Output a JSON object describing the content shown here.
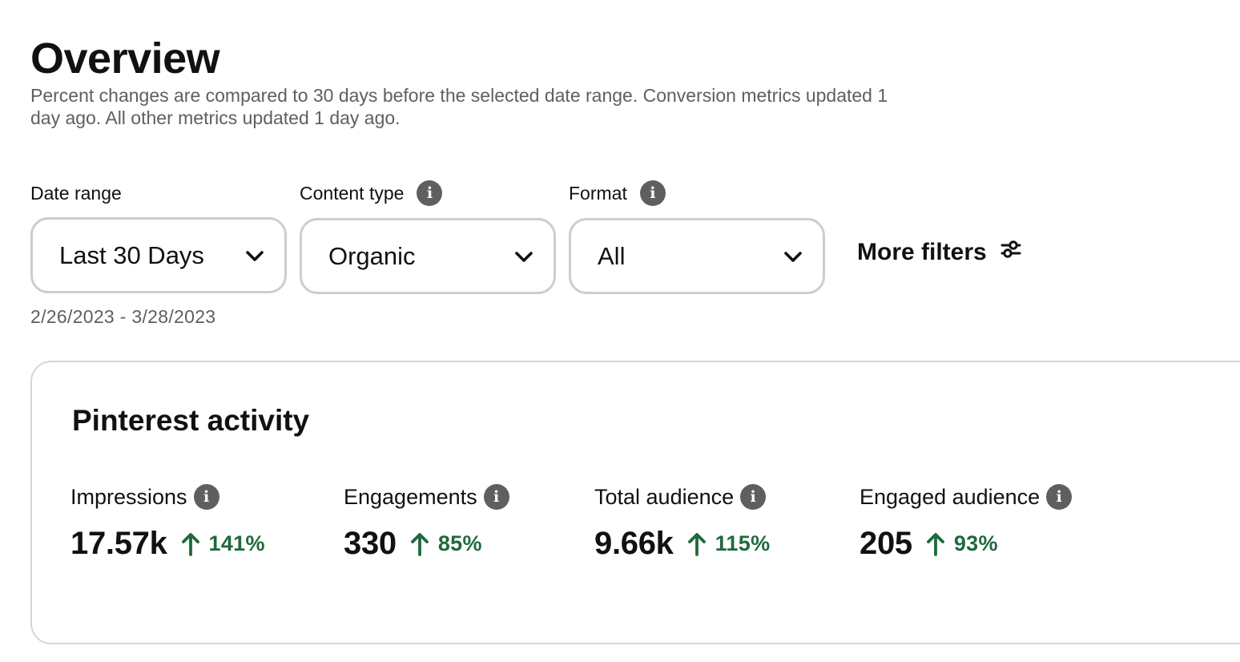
{
  "header": {
    "title": "Overview",
    "subtitle": "Percent changes are compared to 30 days before the selected date range. Conversion metrics updated 1 day ago. All other metrics updated 1 day ago."
  },
  "filters": {
    "date_range": {
      "label": "Date range",
      "value": "Last 30 Days",
      "caption": "2/26/2023 - 3/28/2023"
    },
    "content_type": {
      "label": "Content type",
      "value": "Organic",
      "icon": "info-icon"
    },
    "format": {
      "label": "Format",
      "value": "All",
      "icon": "info-icon"
    },
    "more_filters": {
      "label": "More filters",
      "icon": "sliders-icon"
    }
  },
  "activity": {
    "title": "Pinterest activity",
    "metrics": [
      {
        "label": "Impressions",
        "value": "17.57k",
        "change": "141%",
        "direction": "up"
      },
      {
        "label": "Engagements",
        "value": "330",
        "change": "85%",
        "direction": "up"
      },
      {
        "label": "Total audience",
        "value": "9.66k",
        "change": "115%",
        "direction": "up"
      },
      {
        "label": "Engaged audience",
        "value": "205",
        "change": "93%",
        "direction": "up"
      }
    ]
  },
  "colors": {
    "text": "#111111",
    "muted": "#5f5f5f",
    "border": "#cdcdcd",
    "positive": "#1f6a3c",
    "info_icon_bg": "#5f5f5f"
  }
}
